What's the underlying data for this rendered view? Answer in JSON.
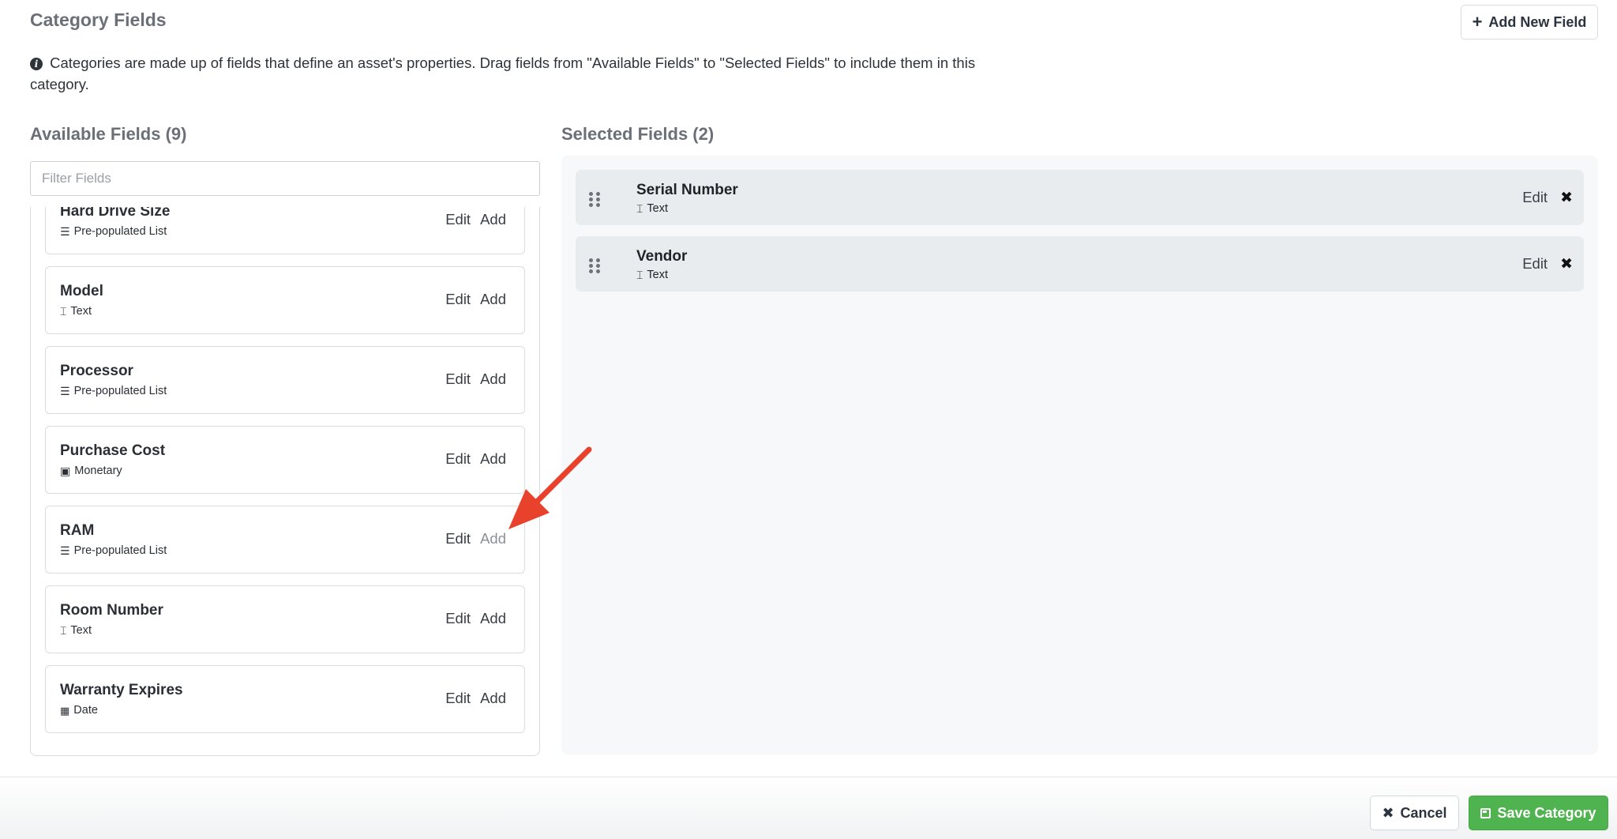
{
  "header": {
    "title": "Category Fields",
    "add_new_field_label": "Add New Field",
    "info_text": "Categories are made up of fields that define an asset's properties. Drag fields from \"Available Fields\" to \"Selected Fields\" to include them in this category."
  },
  "available": {
    "heading": "Available Fields (9)",
    "filter_placeholder": "Filter Fields",
    "fields": [
      {
        "name": "Hard Drive Size",
        "type": "Pre-populated List",
        "icon": "list-icon",
        "edit": "Edit",
        "add": "Add"
      },
      {
        "name": "Model",
        "type": "Text",
        "icon": "text-cursor-icon",
        "edit": "Edit",
        "add": "Add"
      },
      {
        "name": "Processor",
        "type": "Pre-populated List",
        "icon": "list-icon",
        "edit": "Edit",
        "add": "Add"
      },
      {
        "name": "Purchase Cost",
        "type": "Monetary",
        "icon": "money-icon",
        "edit": "Edit",
        "add": "Add"
      },
      {
        "name": "RAM",
        "type": "Pre-populated List",
        "icon": "list-icon",
        "edit": "Edit",
        "add": "Add"
      },
      {
        "name": "Room Number",
        "type": "Text",
        "icon": "text-cursor-icon",
        "edit": "Edit",
        "add": "Add"
      },
      {
        "name": "Warranty Expires",
        "type": "Date",
        "icon": "calendar-icon",
        "edit": "Edit",
        "add": "Add"
      }
    ]
  },
  "selected": {
    "heading": "Selected Fields (2)",
    "fields": [
      {
        "name": "Serial Number",
        "type": "Text",
        "icon": "text-cursor-icon",
        "edit": "Edit"
      },
      {
        "name": "Vendor",
        "type": "Text",
        "icon": "text-cursor-icon",
        "edit": "Edit"
      }
    ]
  },
  "footer": {
    "cancel_label": "Cancel",
    "save_label": "Save Category"
  },
  "colors": {
    "annotation_arrow": "#e8412c",
    "save_button": "#4fb34f"
  }
}
